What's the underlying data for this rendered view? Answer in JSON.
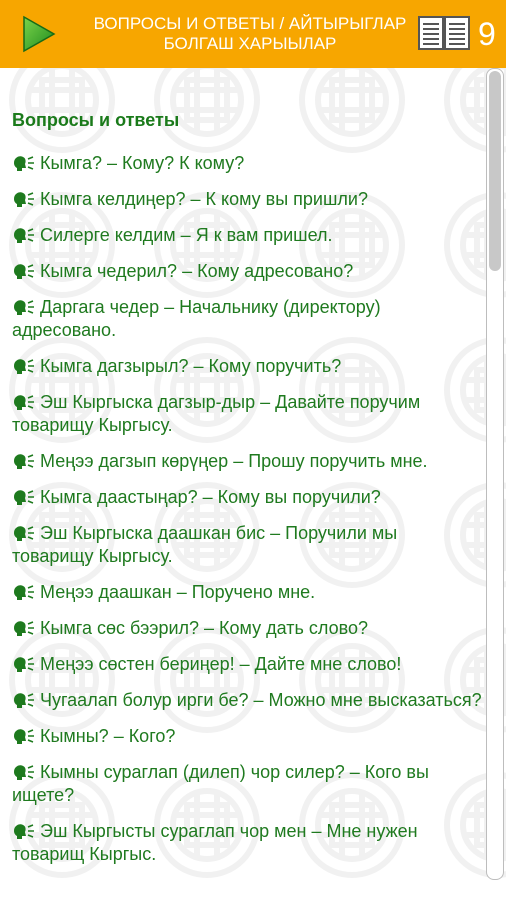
{
  "header": {
    "title_line1": "ВОПРОСЫ И ОТВЕТЫ / АЙТЫРЫГЛАР",
    "title_line2": "БОЛГАШ ХАРЫЫЛАР",
    "page_number": "9",
    "play_icon": "play-icon",
    "book_icon": "book-icon"
  },
  "colors": {
    "header_bg": "#f7a600",
    "text_green": "#1f7a1f",
    "title_green": "#1a7a1a"
  },
  "main": {
    "section_title": "Вопросы и ответы",
    "phrases": [
      "Кымга? – Кому? К кому?",
      "Кымга келдиңер? – К кому вы пришли?",
      "Силерге келдим – Я к вам пришел.",
      "Кымга чедерил? – Кому адресовано?",
      "Даргага чедер – Начальнику (директору) адресовано.",
      "Кымга дагзырыл? – Кому поручить?",
      "Эш Кыргыска дагзыр-дыр – Давайте поручим товарищу Кыргысу.",
      "Меңээ дагзып көрүңер – Прошу поручить мне.",
      "Кымга даастыңар? – Кому вы поручили?",
      "Эш Кыргыска даашкан бис – Поручили мы товарищу Кыргысу.",
      "Меңээ даашкан – Поручено мне.",
      "Кымга сөс бээрил? – Кому дать слово?",
      "Меңээ сөстен бериңер! – Дайте мне слово!",
      "Чугаалап болур ирги бе? – Можно мне высказаться?",
      "Кымны? – Кого?",
      "Кымны сураглап (дилеп) чор силер? – Кого вы ищете?",
      "Эш Кыргысты сураглап чор мен – Мне нужен товарищ Кыргыс."
    ]
  }
}
